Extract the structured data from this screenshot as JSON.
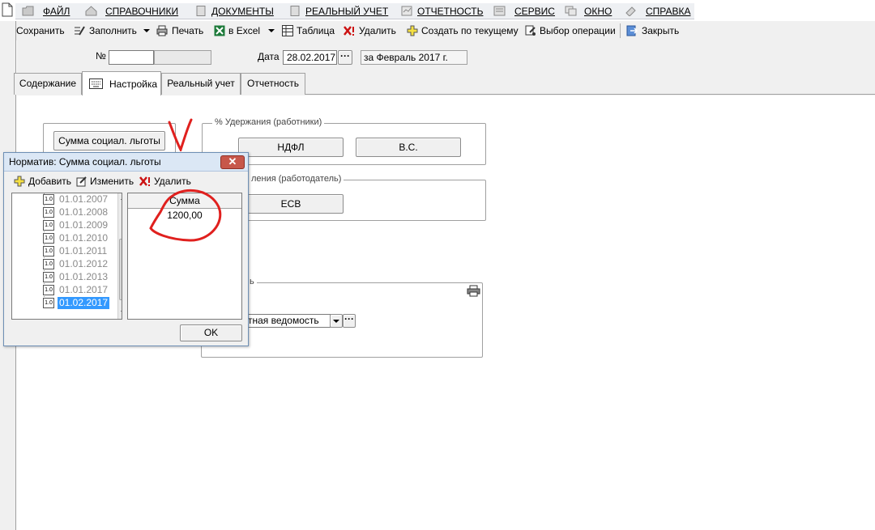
{
  "menu": {
    "items": [
      {
        "label": "ФАЙЛ",
        "icon": "folder-icon"
      },
      {
        "label": "СПРАВОЧНИКИ",
        "icon": "home-icon"
      },
      {
        "label": "ДОКУМЕНТЫ",
        "icon": "document-icon"
      },
      {
        "label": "РЕАЛЬНЫЙ УЧЕТ",
        "icon": "document-icon"
      },
      {
        "label": "ОТЧЕТНОСТЬ",
        "icon": "report-icon"
      },
      {
        "label": "СЕРВИС",
        "icon": "service-icon"
      },
      {
        "label": "ОКНО",
        "icon": "window-icon"
      },
      {
        "label": "СПРАВКА",
        "icon": "help-icon"
      }
    ]
  },
  "toolbar": {
    "save": "Сохранить",
    "fill": "Заполнить",
    "print": "Печать",
    "excel": "в Excel",
    "table": "Таблица",
    "delete": "Удалить",
    "create_from_current": "Создать по текущему",
    "choose_operation": "Выбор операции",
    "close": "Закрыть"
  },
  "header": {
    "number_label": "№",
    "number_value": "",
    "date_label": "Дата",
    "date_value": "28.02.2017",
    "date_button": "···",
    "period_value": "за Февраль 2017 г."
  },
  "tabs": [
    {
      "label": "Содержание",
      "active": false
    },
    {
      "label": "Настройка",
      "active": true
    },
    {
      "label": "Реальный учет",
      "active": false
    },
    {
      "label": "Отчетность",
      "active": false
    }
  ],
  "settings": {
    "benefit_button": "Сумма социал. льготы",
    "deductions_group": "% Удержания (работники)",
    "ndfl_button": "НДФЛ",
    "vs_button": "В.С.",
    "accruals_group_partial": "ления (работодатель)",
    "esv_button": "ЕСВ",
    "print_group_partial": "ь",
    "statement_value": "тная ведомость",
    "statement_more": "···"
  },
  "dialog": {
    "title": "Норматив: Сумма социал. льготы",
    "close": "✕",
    "add": "Добавить",
    "edit": "Изменить",
    "delete": "Удалить",
    "tree_items": [
      "01.01.2007",
      "01.01.2008",
      "01.01.2009",
      "01.01.2010",
      "01.01.2011",
      "01.01.2012",
      "01.01.2013",
      "01.01.2017",
      "01.02.2017"
    ],
    "tree_icon_text": "1.0",
    "grid_header": "Сумма",
    "grid_value": "1200,00",
    "ok": "OK"
  },
  "colors": {
    "annotation": "#e0201e",
    "selection": "#3399ff",
    "excel_green": "#1d7a3a",
    "delete_red": "#cc1111"
  }
}
